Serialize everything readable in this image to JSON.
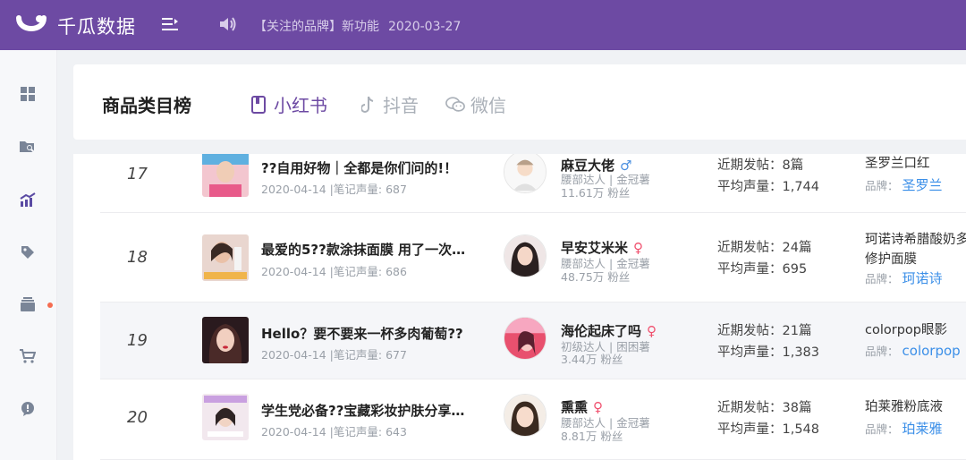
{
  "app": {
    "brand": "千瓜数据"
  },
  "notice": {
    "text": "【关注的品牌】新功能",
    "date": "2020-03-27"
  },
  "header": {
    "title": "商品类目榜",
    "tabs": [
      {
        "label": "小红书",
        "icon": "book-icon",
        "active": true
      },
      {
        "label": "抖音",
        "icon": "music-note-icon",
        "active": false
      },
      {
        "label": "微信",
        "icon": "wechat-icon",
        "active": false
      }
    ]
  },
  "sidebar": {
    "items": [
      {
        "icon": "dashboard-grid-icon"
      },
      {
        "icon": "folder-search-icon"
      },
      {
        "icon": "trend-chart-icon"
      },
      {
        "icon": "tag-icon"
      },
      {
        "icon": "layers-icon"
      },
      {
        "icon": "cart-icon"
      },
      {
        "icon": "chat-bubble-icon"
      }
    ]
  },
  "labels": {
    "date_sep": "|",
    "volume_label": "笔记声量:",
    "fans_suffix": "粉丝",
    "posts_label": "近期发帖：",
    "avg_label": "平均声量：",
    "brand_label": "品牌："
  },
  "rows": [
    {
      "rank": "17",
      "title": "??自用好物｜全都是你们问的!！",
      "date": "2020-04-14",
      "volume": "687",
      "nickname": "麻豆大佬",
      "gender": "male",
      "gender_symbol": "♂",
      "level": "腰部达人",
      "badge": "金冠薯",
      "fans": "11.61万",
      "posts": "8篇",
      "avg": "1,744",
      "product_lines": [
        "圣罗兰口红"
      ],
      "brand": "圣罗兰"
    },
    {
      "rank": "18",
      "title": "最爱的5??款涂抹面膜 用了一次…",
      "date": "2020-04-14",
      "volume": "686",
      "nickname": "早安艾米米",
      "gender": "female",
      "gender_symbol": "♀",
      "level": "腰部达人",
      "badge": "金冠薯",
      "fans": "48.75万",
      "posts": "24篇",
      "avg": "695",
      "product_lines": [
        "珂诺诗希腊酸奶多",
        "修护面膜"
      ],
      "brand": "珂诺诗"
    },
    {
      "rank": "19",
      "title": "Hello？要不要来一杯多肉葡萄??",
      "date": "2020-04-14",
      "volume": "677",
      "nickname": "海伦起床了吗",
      "gender": "female",
      "gender_symbol": "♀",
      "level": "初级达人",
      "badge": "困困薯",
      "fans": "3.44万",
      "posts": "21篇",
      "avg": "1,383",
      "product_lines": [
        "colorpop眼影"
      ],
      "brand": "colorpop"
    },
    {
      "rank": "20",
      "title": "学生党必备??宝藏彩妆护肤分享…",
      "date": "2020-04-14",
      "volume": "643",
      "nickname": "熏熏",
      "gender": "female",
      "gender_symbol": "♀",
      "level": "腰部达人",
      "badge": "金冠薯",
      "fans": "8.81万",
      "posts": "38篇",
      "avg": "1,548",
      "product_lines": [
        "珀莱雅粉底液"
      ],
      "brand": "珀莱雅"
    }
  ]
}
